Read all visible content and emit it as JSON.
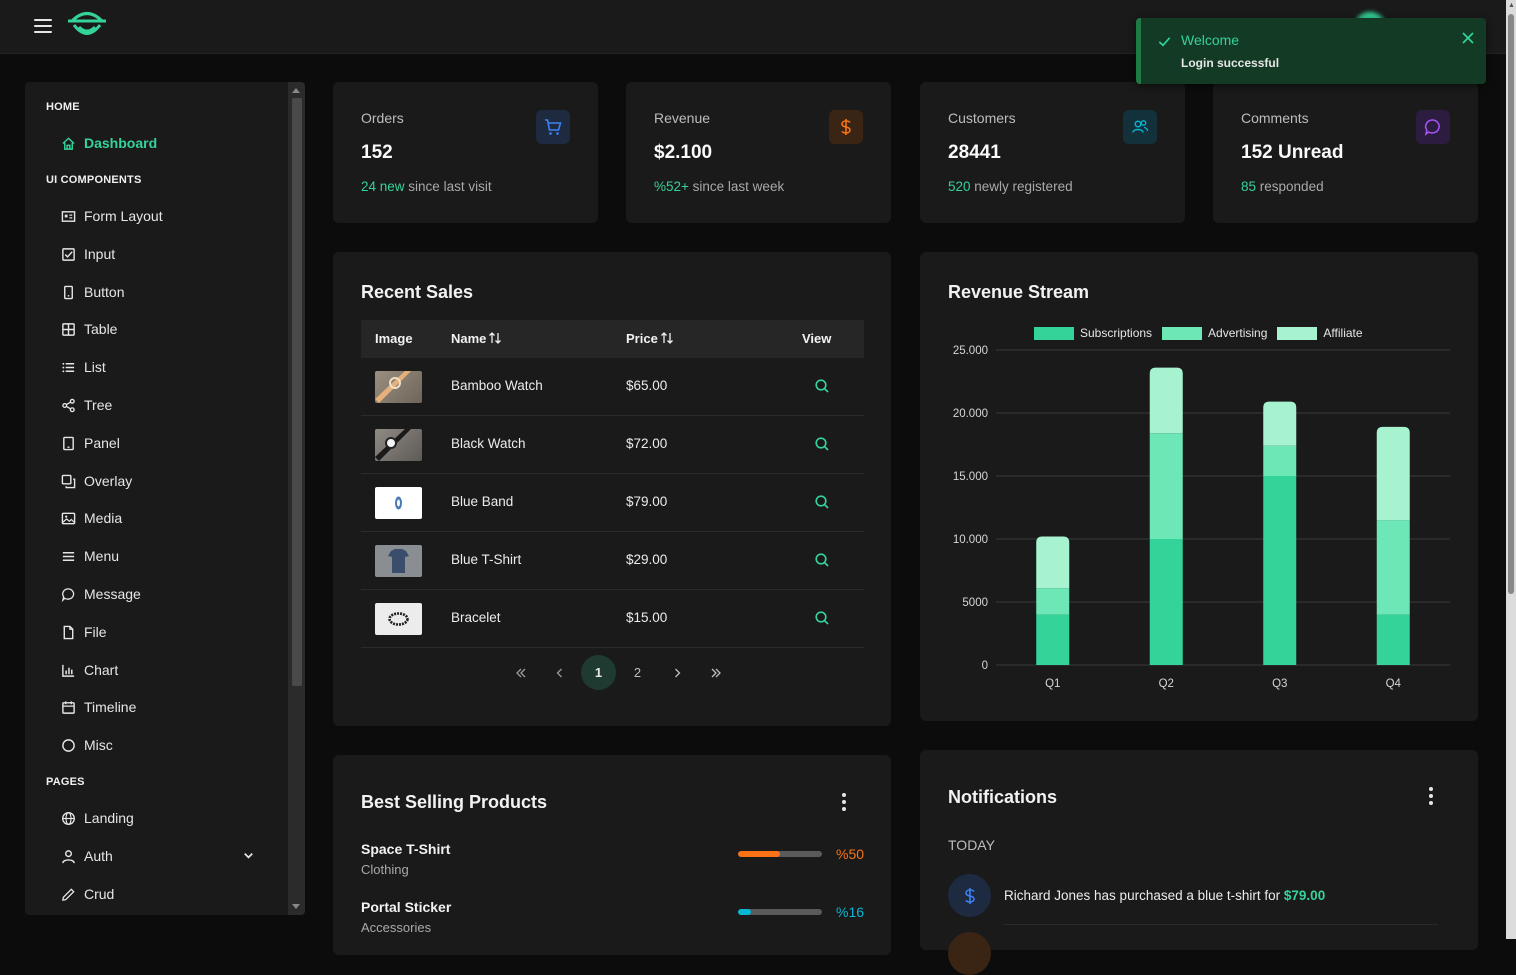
{
  "colors": {
    "accent": "#34d399",
    "orange": "#f97316",
    "blue": "#3b82f6",
    "cyan": "#06b6d4",
    "purple": "#a855f7"
  },
  "sidebar": {
    "sections": [
      "HOME",
      "UI COMPONENTS",
      "PAGES"
    ],
    "home_items": [
      {
        "label": "Dashboard",
        "icon": "home-icon",
        "active": true
      }
    ],
    "ui_items": [
      {
        "label": "Form Layout",
        "icon": "id-card-icon"
      },
      {
        "label": "Input",
        "icon": "check-square-icon"
      },
      {
        "label": "Button",
        "icon": "mobile-icon"
      },
      {
        "label": "Table",
        "icon": "table-icon"
      },
      {
        "label": "List",
        "icon": "list-icon"
      },
      {
        "label": "Tree",
        "icon": "share-icon"
      },
      {
        "label": "Panel",
        "icon": "tablet-icon"
      },
      {
        "label": "Overlay",
        "icon": "clone-icon"
      },
      {
        "label": "Media",
        "icon": "image-icon"
      },
      {
        "label": "Menu",
        "icon": "bars-icon"
      },
      {
        "label": "Message",
        "icon": "comment-icon"
      },
      {
        "label": "File",
        "icon": "file-icon"
      },
      {
        "label": "Chart",
        "icon": "chart-bar-icon"
      },
      {
        "label": "Timeline",
        "icon": "calendar-icon"
      },
      {
        "label": "Misc",
        "icon": "circle-icon"
      }
    ],
    "page_items": [
      {
        "label": "Landing",
        "icon": "globe-icon"
      },
      {
        "label": "Auth",
        "icon": "user-icon"
      },
      {
        "label": "Crud",
        "icon": "pencil-icon"
      }
    ]
  },
  "stats": [
    {
      "title": "Orders",
      "value": "152",
      "highlight": "24 new",
      "sub": " since last visit",
      "icon": "cart-icon"
    },
    {
      "title": "Revenue",
      "value": "$2.100",
      "highlight": "%52+",
      "sub": " since last week",
      "icon": "dollar-icon"
    },
    {
      "title": "Customers",
      "value": "28441",
      "highlight": "520",
      "sub": " newly registered",
      "icon": "users-icon"
    },
    {
      "title": "Comments",
      "value": "152 Unread",
      "highlight": "85",
      "sub": " responded",
      "icon": "comment-icon"
    }
  ],
  "recent_sales": {
    "title": "Recent Sales",
    "headers": {
      "image": "Image",
      "name": "Name",
      "price": "Price",
      "view": "View"
    },
    "rows": [
      {
        "name": "Bamboo Watch",
        "price": "$65.00"
      },
      {
        "name": "Black Watch",
        "price": "$72.00"
      },
      {
        "name": "Blue Band",
        "price": "$79.00"
      },
      {
        "name": "Blue T-Shirt",
        "price": "$29.00"
      },
      {
        "name": "Bracelet",
        "price": "$15.00"
      }
    ],
    "pages": [
      "1",
      "2"
    ],
    "current_page": "1"
  },
  "revenue_stream": {
    "title": "Revenue Stream"
  },
  "chart_data": {
    "type": "bar",
    "stacked": true,
    "categories": [
      "Q1",
      "Q2",
      "Q3",
      "Q4"
    ],
    "series": [
      {
        "name": "Subscriptions",
        "color": "#34d399",
        "values": [
          4000,
          10000,
          15000,
          4000
        ]
      },
      {
        "name": "Advertising",
        "color": "#6ee7b7",
        "values": [
          2100,
          8400,
          2400,
          7500
        ]
      },
      {
        "name": "Affiliate",
        "color": "#a7f3d0",
        "values": [
          4100,
          5200,
          3500,
          7400
        ]
      }
    ],
    "yticks": [
      "0",
      "5000",
      "10.000",
      "15.000",
      "20.000",
      "25.000"
    ],
    "ylim": [
      0,
      25000
    ],
    "grid": true,
    "legend": "top-center"
  },
  "best_selling": {
    "title": "Best Selling Products",
    "items": [
      {
        "name": "Space T-Shirt",
        "category": "Clothing",
        "percent": 50,
        "label": "%50",
        "color": "#f97316"
      },
      {
        "name": "Portal Sticker",
        "category": "Accessories",
        "percent": 16,
        "label": "%16",
        "color": "#06b6d4"
      }
    ]
  },
  "notifications": {
    "title": "Notifications",
    "group": "TODAY",
    "items": [
      {
        "text": "Richard Jones has purchased a blue t-shirt for ",
        "amount": "$79.00",
        "icon": "dollar-icon"
      }
    ]
  },
  "toast": {
    "title": "Welcome",
    "message": "Login successful"
  }
}
